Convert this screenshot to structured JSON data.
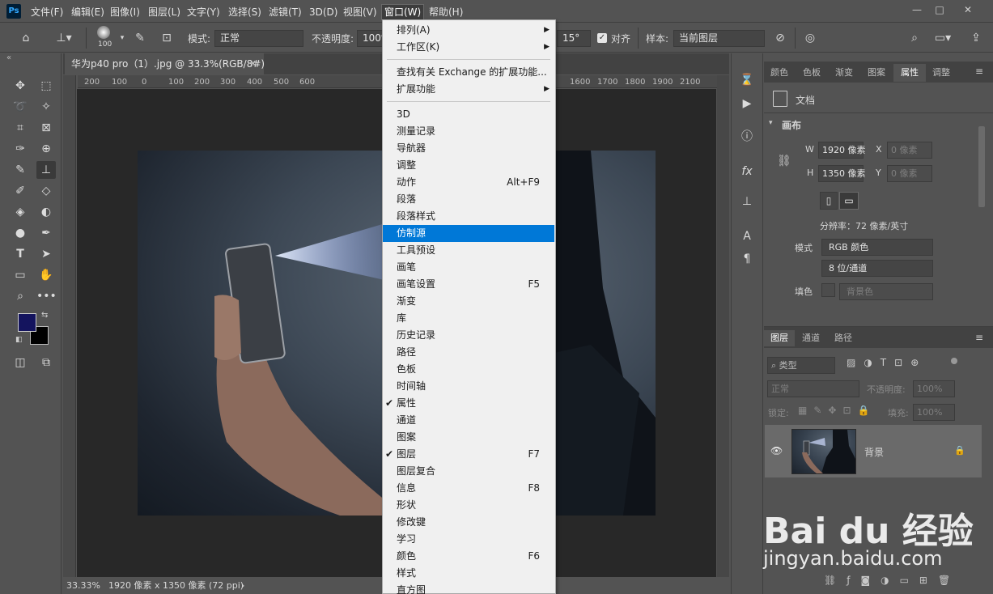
{
  "menubar": {
    "logo": "Ps",
    "items": [
      "文件(F)",
      "编辑(E)",
      "图像(I)",
      "图层(L)",
      "文字(Y)",
      "选择(S)",
      "滤镜(T)",
      "3D(D)",
      "视图(V)",
      "窗口(W)",
      "帮助(H)"
    ],
    "active_item": "窗口(W)",
    "window_controls": [
      "—",
      "□",
      "✕"
    ]
  },
  "options": {
    "brush_size": "100",
    "mode_label": "模式:",
    "mode_value": "正常",
    "opacity_label": "不透明度:",
    "opacity_value": "100%",
    "angle_value": "15°",
    "align_label": "对齐",
    "sample_label": "样本:",
    "sample_value": "当前图层"
  },
  "document": {
    "tab_title": "华为p40 pro（1）.jpg @ 33.3%(RGB/8#)",
    "ruler_marks": [
      "200",
      "100",
      "0",
      "100",
      "200",
      "300",
      "400",
      "500",
      "600",
      "1600",
      "1700",
      "1800",
      "1900",
      "2100"
    ],
    "status_zoom": "33.33%",
    "status_info": "1920 像素 x 1350 像素 (72 ppi)"
  },
  "window_menu": {
    "items": [
      {
        "label": "排列(A)",
        "submenu": true
      },
      {
        "label": "工作区(K)",
        "submenu": true
      },
      {
        "sep": true
      },
      {
        "label": "查找有关 Exchange 的扩展功能..."
      },
      {
        "label": "扩展功能",
        "submenu": true
      },
      {
        "sep": true
      },
      {
        "label": "3D"
      },
      {
        "label": "测量记录"
      },
      {
        "label": "导航器"
      },
      {
        "label": "调整"
      },
      {
        "label": "动作",
        "shortcut": "Alt+F9"
      },
      {
        "label": "段落"
      },
      {
        "label": "段落样式"
      },
      {
        "label": "仿制源",
        "highlighted": true
      },
      {
        "label": "工具预设"
      },
      {
        "label": "画笔"
      },
      {
        "label": "画笔设置",
        "shortcut": "F5"
      },
      {
        "label": "渐变"
      },
      {
        "label": "库"
      },
      {
        "label": "历史记录"
      },
      {
        "label": "路径"
      },
      {
        "label": "色板"
      },
      {
        "label": "时间轴"
      },
      {
        "label": "属性",
        "checked": true
      },
      {
        "label": "通道"
      },
      {
        "label": "图案"
      },
      {
        "label": "图层",
        "shortcut": "F7",
        "checked": true
      },
      {
        "label": "图层复合"
      },
      {
        "label": "信息",
        "shortcut": "F8"
      },
      {
        "label": "形状"
      },
      {
        "label": "修改键"
      },
      {
        "label": "学习"
      },
      {
        "label": "颜色",
        "shortcut": "F6"
      },
      {
        "label": "样式"
      },
      {
        "label": "直方图"
      }
    ]
  },
  "properties_panel": {
    "tabs": [
      "颜色",
      "色板",
      "渐变",
      "图案",
      "属性",
      "调整"
    ],
    "active_tab": "属性",
    "doc_label": "文档",
    "canvas_header": "画布",
    "w_label": "W",
    "w_value": "1920 像素",
    "h_label": "H",
    "h_value": "1350 像素",
    "x_label": "X",
    "x_placeholder": "0 像素",
    "y_label": "Y",
    "y_placeholder": "0 像素",
    "resolution": "分辨率：72 像素/英寸",
    "mode_label": "模式",
    "mode_value": "RGB 颜色",
    "depth_value": "8 位/通道",
    "fill_label": "填色",
    "fill_value": "背景色"
  },
  "layers_panel": {
    "tabs": [
      "图层",
      "通道",
      "路径"
    ],
    "active_tab": "图层",
    "filter_placeholder": "类型",
    "blend_value": "正常",
    "opacity_label": "不透明度:",
    "opacity_value": "100%",
    "lock_label": "锁定:",
    "fill_label": "填充:",
    "fill_value": "100%",
    "layer_name": "背景"
  },
  "watermark": {
    "line1": "Bai du 经验",
    "line2": "jingyan.baidu.com"
  },
  "colors": {
    "foreground": "#14145e",
    "background": "#000000",
    "menu_highlight": "#0078d7"
  }
}
